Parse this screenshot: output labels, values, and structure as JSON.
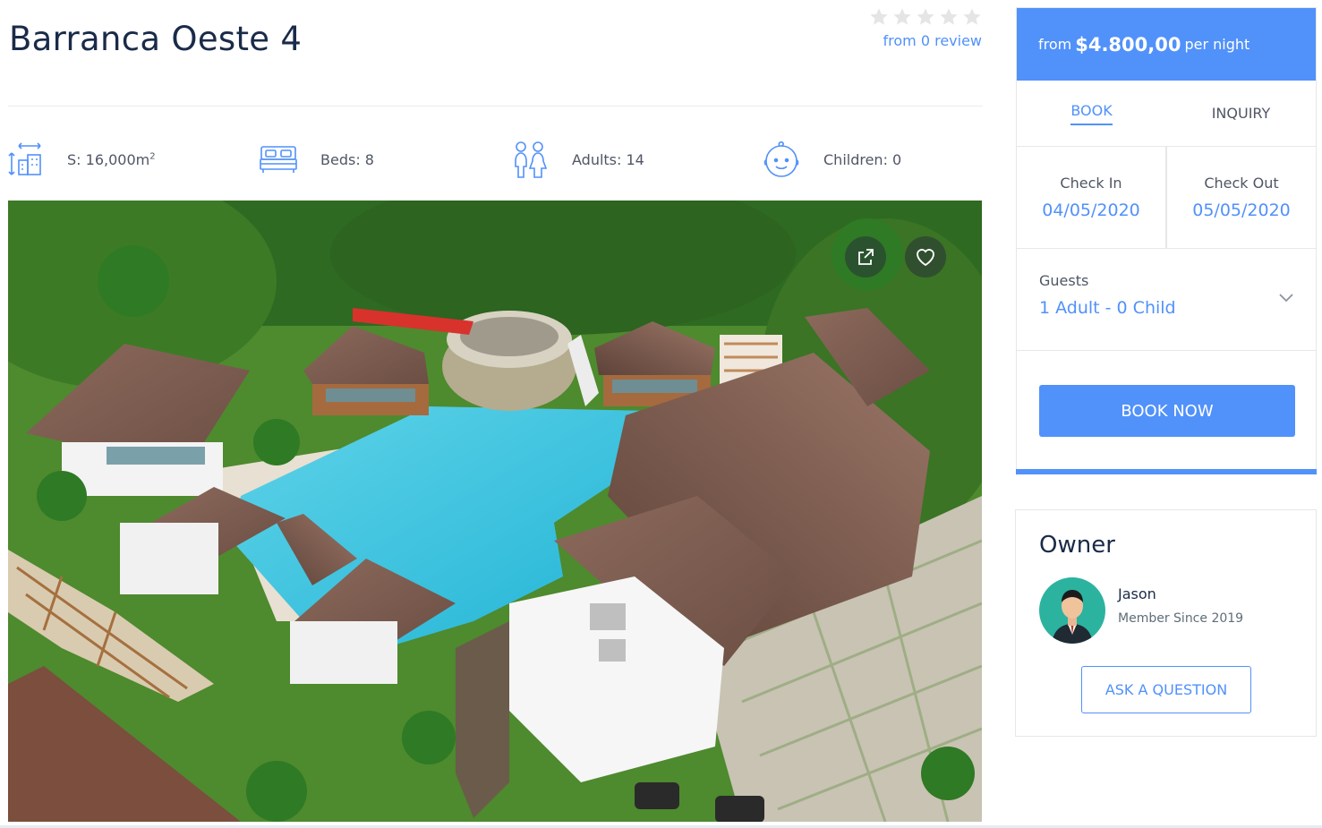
{
  "listing": {
    "title": "Barranca Oeste 4",
    "rating": {
      "stars": 0,
      "max_stars": 5,
      "review_text": "from 0 review"
    }
  },
  "facts": [
    {
      "icon": "area-icon",
      "label": "S: 16,000m",
      "sup": "2"
    },
    {
      "icon": "bed-icon",
      "label": "Beds: 8"
    },
    {
      "icon": "adults-icon",
      "label": "Adults: 14"
    },
    {
      "icon": "child-face-icon",
      "label": "Children: 0"
    }
  ],
  "photo": {
    "share_icon": "share-icon",
    "favorite_icon": "heart-icon"
  },
  "booking": {
    "price_prefix": "from",
    "price": "$4.800,00",
    "price_suffix": "per night",
    "tabs": [
      {
        "label": "BOOK",
        "active": true
      },
      {
        "label": "INQUIRY",
        "active": false
      }
    ],
    "check_in": {
      "label": "Check In",
      "value": "04/05/2020"
    },
    "check_out": {
      "label": "Check Out",
      "value": "05/05/2020"
    },
    "guests": {
      "label": "Guests",
      "value": "1 Adult - 0 Child"
    },
    "book_now_label": "BOOK NOW"
  },
  "owner": {
    "heading": "Owner",
    "name": "Jason",
    "member_since": "Member Since 2019",
    "ask_label": "ASK A QUESTION"
  },
  "colors": {
    "accent": "#5191fa",
    "title": "#1a2b49",
    "text": "#4f5665",
    "border": "#e7e7e7"
  }
}
